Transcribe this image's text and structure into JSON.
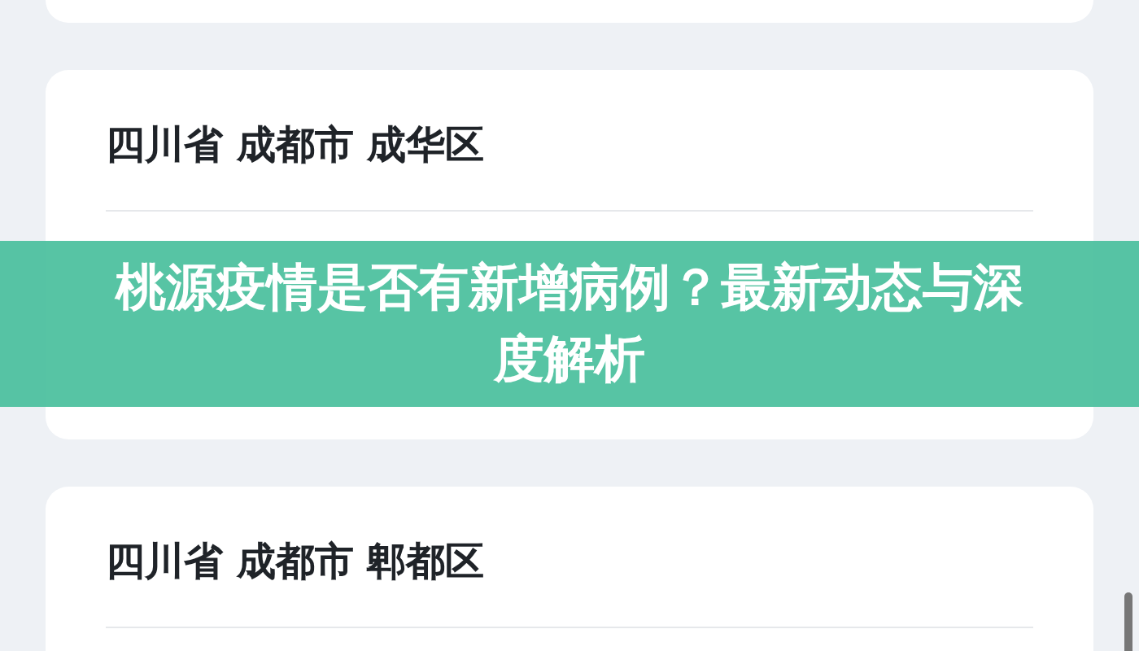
{
  "cards": [
    {
      "title": "四川省 成都市 成华区"
    },
    {
      "title": "四川省 成都市 郫都区"
    }
  ],
  "banner": {
    "headline": "桃源疫情是否有新增病例？最新动态与深度解析"
  }
}
